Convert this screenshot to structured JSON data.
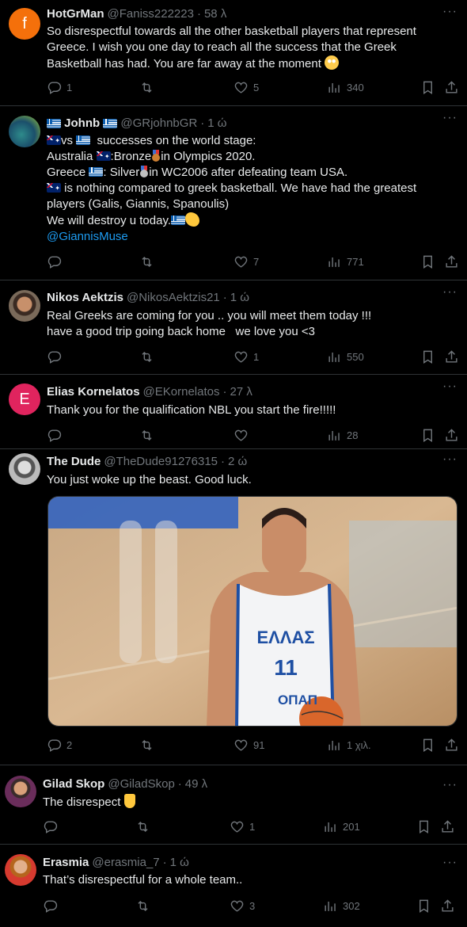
{
  "tweets": [
    {
      "name": "HotGrMan",
      "handle": "@Faniss222223",
      "time": "58 λ",
      "avatar_letter": "f",
      "avatar_color": "#f4700b",
      "lines": [
        "So disrespectful towards all the other basketball players that represent",
        "Greece. I wish you one day to reach all the success that the Greek",
        "Basketball has had. You are far away at the moment"
      ],
      "reply": "1",
      "retweet": "",
      "like": "5",
      "views": "340"
    },
    {
      "name": "Johnb",
      "handle": "@GRjohnbGR",
      "time": "1 ώ",
      "l1": "vs",
      "l1b": "successes on the world stage:",
      "l2a": "Australia",
      "l2b": ":Bronze",
      "l2c": "in Olympics 2020.",
      "l3a": "Greece",
      "l3b": ": Silver",
      "l3c": "in WC2006 after defeating team USA.",
      "l4": "is nothing compared to greek basketball. We have had the greatest",
      "l5": "players (Galis, Giannis, Spanoulis)",
      "l6": "We will destroy u today.",
      "mention": "@GiannisMuse",
      "reply": "",
      "retweet": "",
      "like": "7",
      "views": "771"
    },
    {
      "name": "Nikos Aektzis",
      "handle": "@NikosAektzis21",
      "time": "1 ώ",
      "lines": [
        "Real Greeks are coming for you .. you will meet them today !!!",
        "have a good trip going back home   we love you <3"
      ],
      "reply": "",
      "retweet": "",
      "like": "1",
      "views": "550"
    },
    {
      "name": "Elias Kornelatos",
      "handle": "@EKornelatos",
      "time": "27 λ",
      "avatar_letter": "E",
      "avatar_color": "#e0245e",
      "lines": [
        "Thank you for the qualification NBL you start the fire!!!!!"
      ],
      "reply": "",
      "retweet": "",
      "like": "",
      "views": "28"
    },
    {
      "name": "The Dude",
      "handle": "@TheDude91276315",
      "time": "2 ώ",
      "lines": [
        "You just woke up the beast. Good luck."
      ],
      "jersey_text": "ΕΛΛΑΣ",
      "jersey_number": "11",
      "sponsor": "ΟΠΑΠ",
      "reply": "2",
      "retweet": "",
      "like": "91",
      "views": "1 χιλ."
    },
    {
      "name": "Gilad Skop",
      "handle": "@GiladSkop",
      "time": "49 λ",
      "lines": [
        "The disrespect"
      ],
      "reply": "",
      "retweet": "",
      "like": "1",
      "views": "201"
    },
    {
      "name": "Erasmia",
      "handle": "@erasmia_7",
      "time": "1 ώ",
      "lines": [
        "That’s disrespectful for a whole team.."
      ],
      "reply": "",
      "retweet": "",
      "like": "3",
      "views": "302"
    }
  ],
  "sep": "·",
  "more": "···",
  "icons": [
    "reply-icon",
    "retweet-icon",
    "like-icon",
    "views-icon",
    "bookmark-icon",
    "share-icon"
  ],
  "colors": {
    "link": "#1d9bf0",
    "muted": "#71767b",
    "text": "#e7e9ea",
    "border": "#2f3336"
  }
}
